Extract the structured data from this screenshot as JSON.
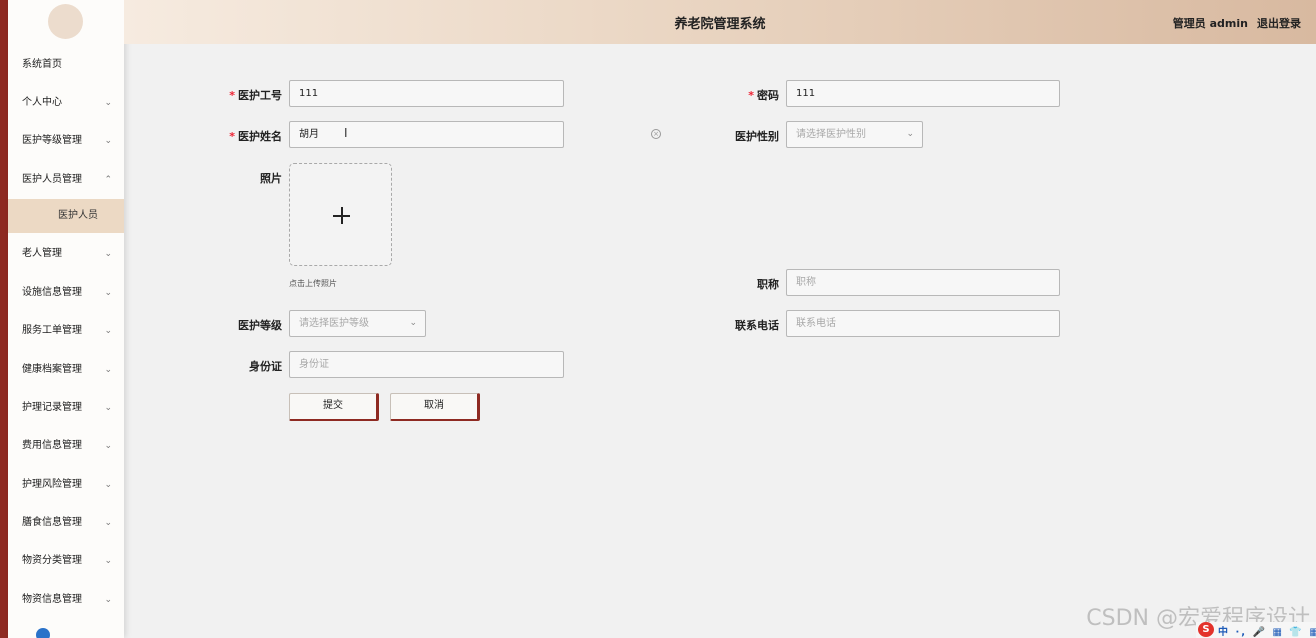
{
  "header": {
    "title": "养老院管理系统",
    "user": "管理员 admin",
    "logout": "退出登录"
  },
  "sidebar": {
    "items": [
      {
        "label": "系统首页",
        "chevron": ""
      },
      {
        "label": "个人中心",
        "chevron": "⌄"
      },
      {
        "label": "医护等级管理",
        "chevron": "⌄"
      },
      {
        "label": "医护人员管理",
        "chevron": "⌃"
      },
      {
        "label": "老人管理",
        "chevron": "⌄"
      },
      {
        "label": "设施信息管理",
        "chevron": "⌄"
      },
      {
        "label": "服务工单管理",
        "chevron": "⌄"
      },
      {
        "label": "健康档案管理",
        "chevron": "⌄"
      },
      {
        "label": "护理记录管理",
        "chevron": "⌄"
      },
      {
        "label": "费用信息管理",
        "chevron": "⌄"
      },
      {
        "label": "护理风险管理",
        "chevron": "⌄"
      },
      {
        "label": "膳食信息管理",
        "chevron": "⌄"
      },
      {
        "label": "物资分类管理",
        "chevron": "⌄"
      },
      {
        "label": "物资信息管理",
        "chevron": "⌄"
      }
    ],
    "sub_item": "医护人员"
  },
  "form": {
    "staff_id": {
      "label": "医护工号",
      "value": "111"
    },
    "password": {
      "label": "密码",
      "value": "111"
    },
    "staff_name": {
      "label": "医护姓名",
      "value": "胡月"
    },
    "gender": {
      "label": "医护性别",
      "placeholder": "请选择医护性别"
    },
    "photo": {
      "label": "照片",
      "hint": "点击上传照片"
    },
    "title": {
      "label": "职称",
      "placeholder": "职称"
    },
    "level": {
      "label": "医护等级",
      "placeholder": "请选择医护等级"
    },
    "phone": {
      "label": "联系电话",
      "placeholder": "联系电话"
    },
    "id_card": {
      "label": "身份证",
      "placeholder": "身份证"
    },
    "submit": "提交",
    "cancel": "取消",
    "required_mark": "*"
  },
  "watermark": "CSDN @宏爱程序设计",
  "tray": {
    "badge": "S",
    "text": "中 ·, 🎤 ▦ 👕 ▦"
  }
}
